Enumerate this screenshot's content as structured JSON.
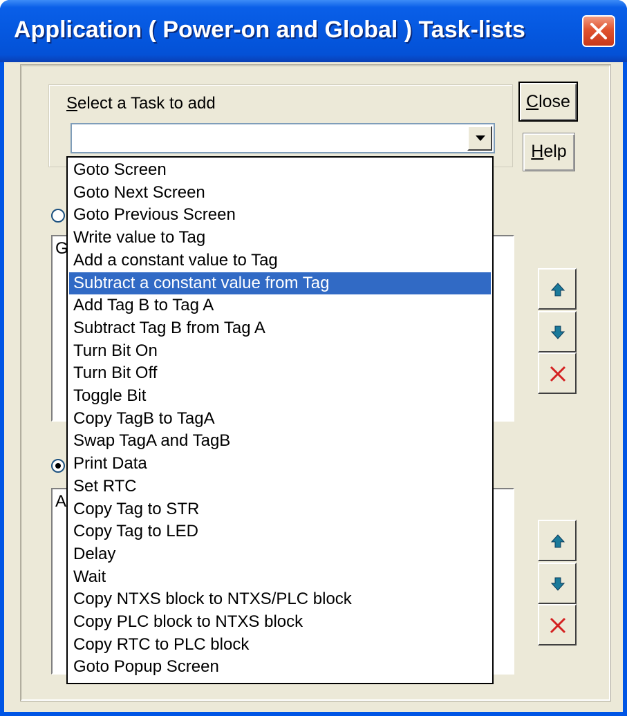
{
  "window": {
    "title": "Application ( Power-on and Global ) Task-lists",
    "close_icon": "close-x-icon"
  },
  "select_task": {
    "label_accel": "S",
    "label_rest": "elect a Task to add",
    "value": ""
  },
  "buttons": {
    "close_accel": "C",
    "close_rest": "lose",
    "help_accel": "H",
    "help_rest": "elp"
  },
  "power_on_section": {
    "list_text": "G"
  },
  "global_section": {
    "list_text": "A"
  },
  "icons": {
    "up": "arrow-up-icon",
    "down": "arrow-down-icon",
    "delete": "delete-x-icon"
  },
  "dropdown": {
    "selected_index": 5,
    "items": [
      "Goto Screen",
      "Goto Next Screen",
      "Goto Previous Screen",
      "Write value to Tag",
      "Add a constant value to Tag",
      "Subtract a constant value from Tag",
      "Add Tag B to Tag A",
      "Subtract Tag B from Tag A",
      "Turn Bit On",
      "Turn Bit Off",
      "Toggle Bit",
      "Copy TagB to TagA",
      "Swap TagA and TagB",
      "Print Data",
      "Set RTC",
      "Copy Tag to STR",
      "Copy Tag to LED",
      "Delay",
      "Wait",
      "Copy NTXS block to NTXS/PLC block",
      "Copy PLC block to NTXS block",
      "Copy RTC to PLC block",
      "Goto Popup Screen"
    ]
  },
  "colors": {
    "titlebar": "#0558e0",
    "face": "#ece9d8",
    "selection": "#316ac5"
  }
}
